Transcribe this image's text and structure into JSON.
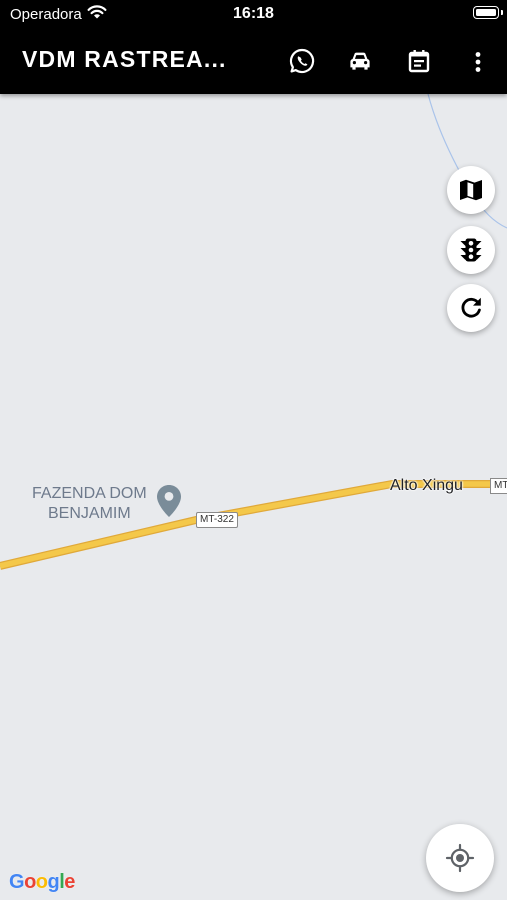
{
  "status_bar": {
    "carrier": "Operadora",
    "time": "16:18"
  },
  "app_bar": {
    "title": "VDM RASTREA...",
    "actions": [
      "whatsapp-icon",
      "car-icon",
      "calendar-icon",
      "more-vert-icon"
    ]
  },
  "map": {
    "poi_label": "FAZENDA DOM\nBENJAMIM",
    "road_shield": "MT-322",
    "place_label": "Alto Xingu",
    "road_shield_2": "MT",
    "road_color": "#f4c84a",
    "background_color": "#e8eaed"
  },
  "map_controls": [
    "map-type-icon",
    "traffic-light-icon",
    "refresh-icon"
  ],
  "location_button": "my-location-icon",
  "attribution": {
    "letters": [
      "G",
      "o",
      "o",
      "g",
      "l",
      "e"
    ],
    "colors": [
      "#4285F4",
      "#EA4335",
      "#FBBC05",
      "#4285F4",
      "#34A853",
      "#EA4335"
    ]
  }
}
